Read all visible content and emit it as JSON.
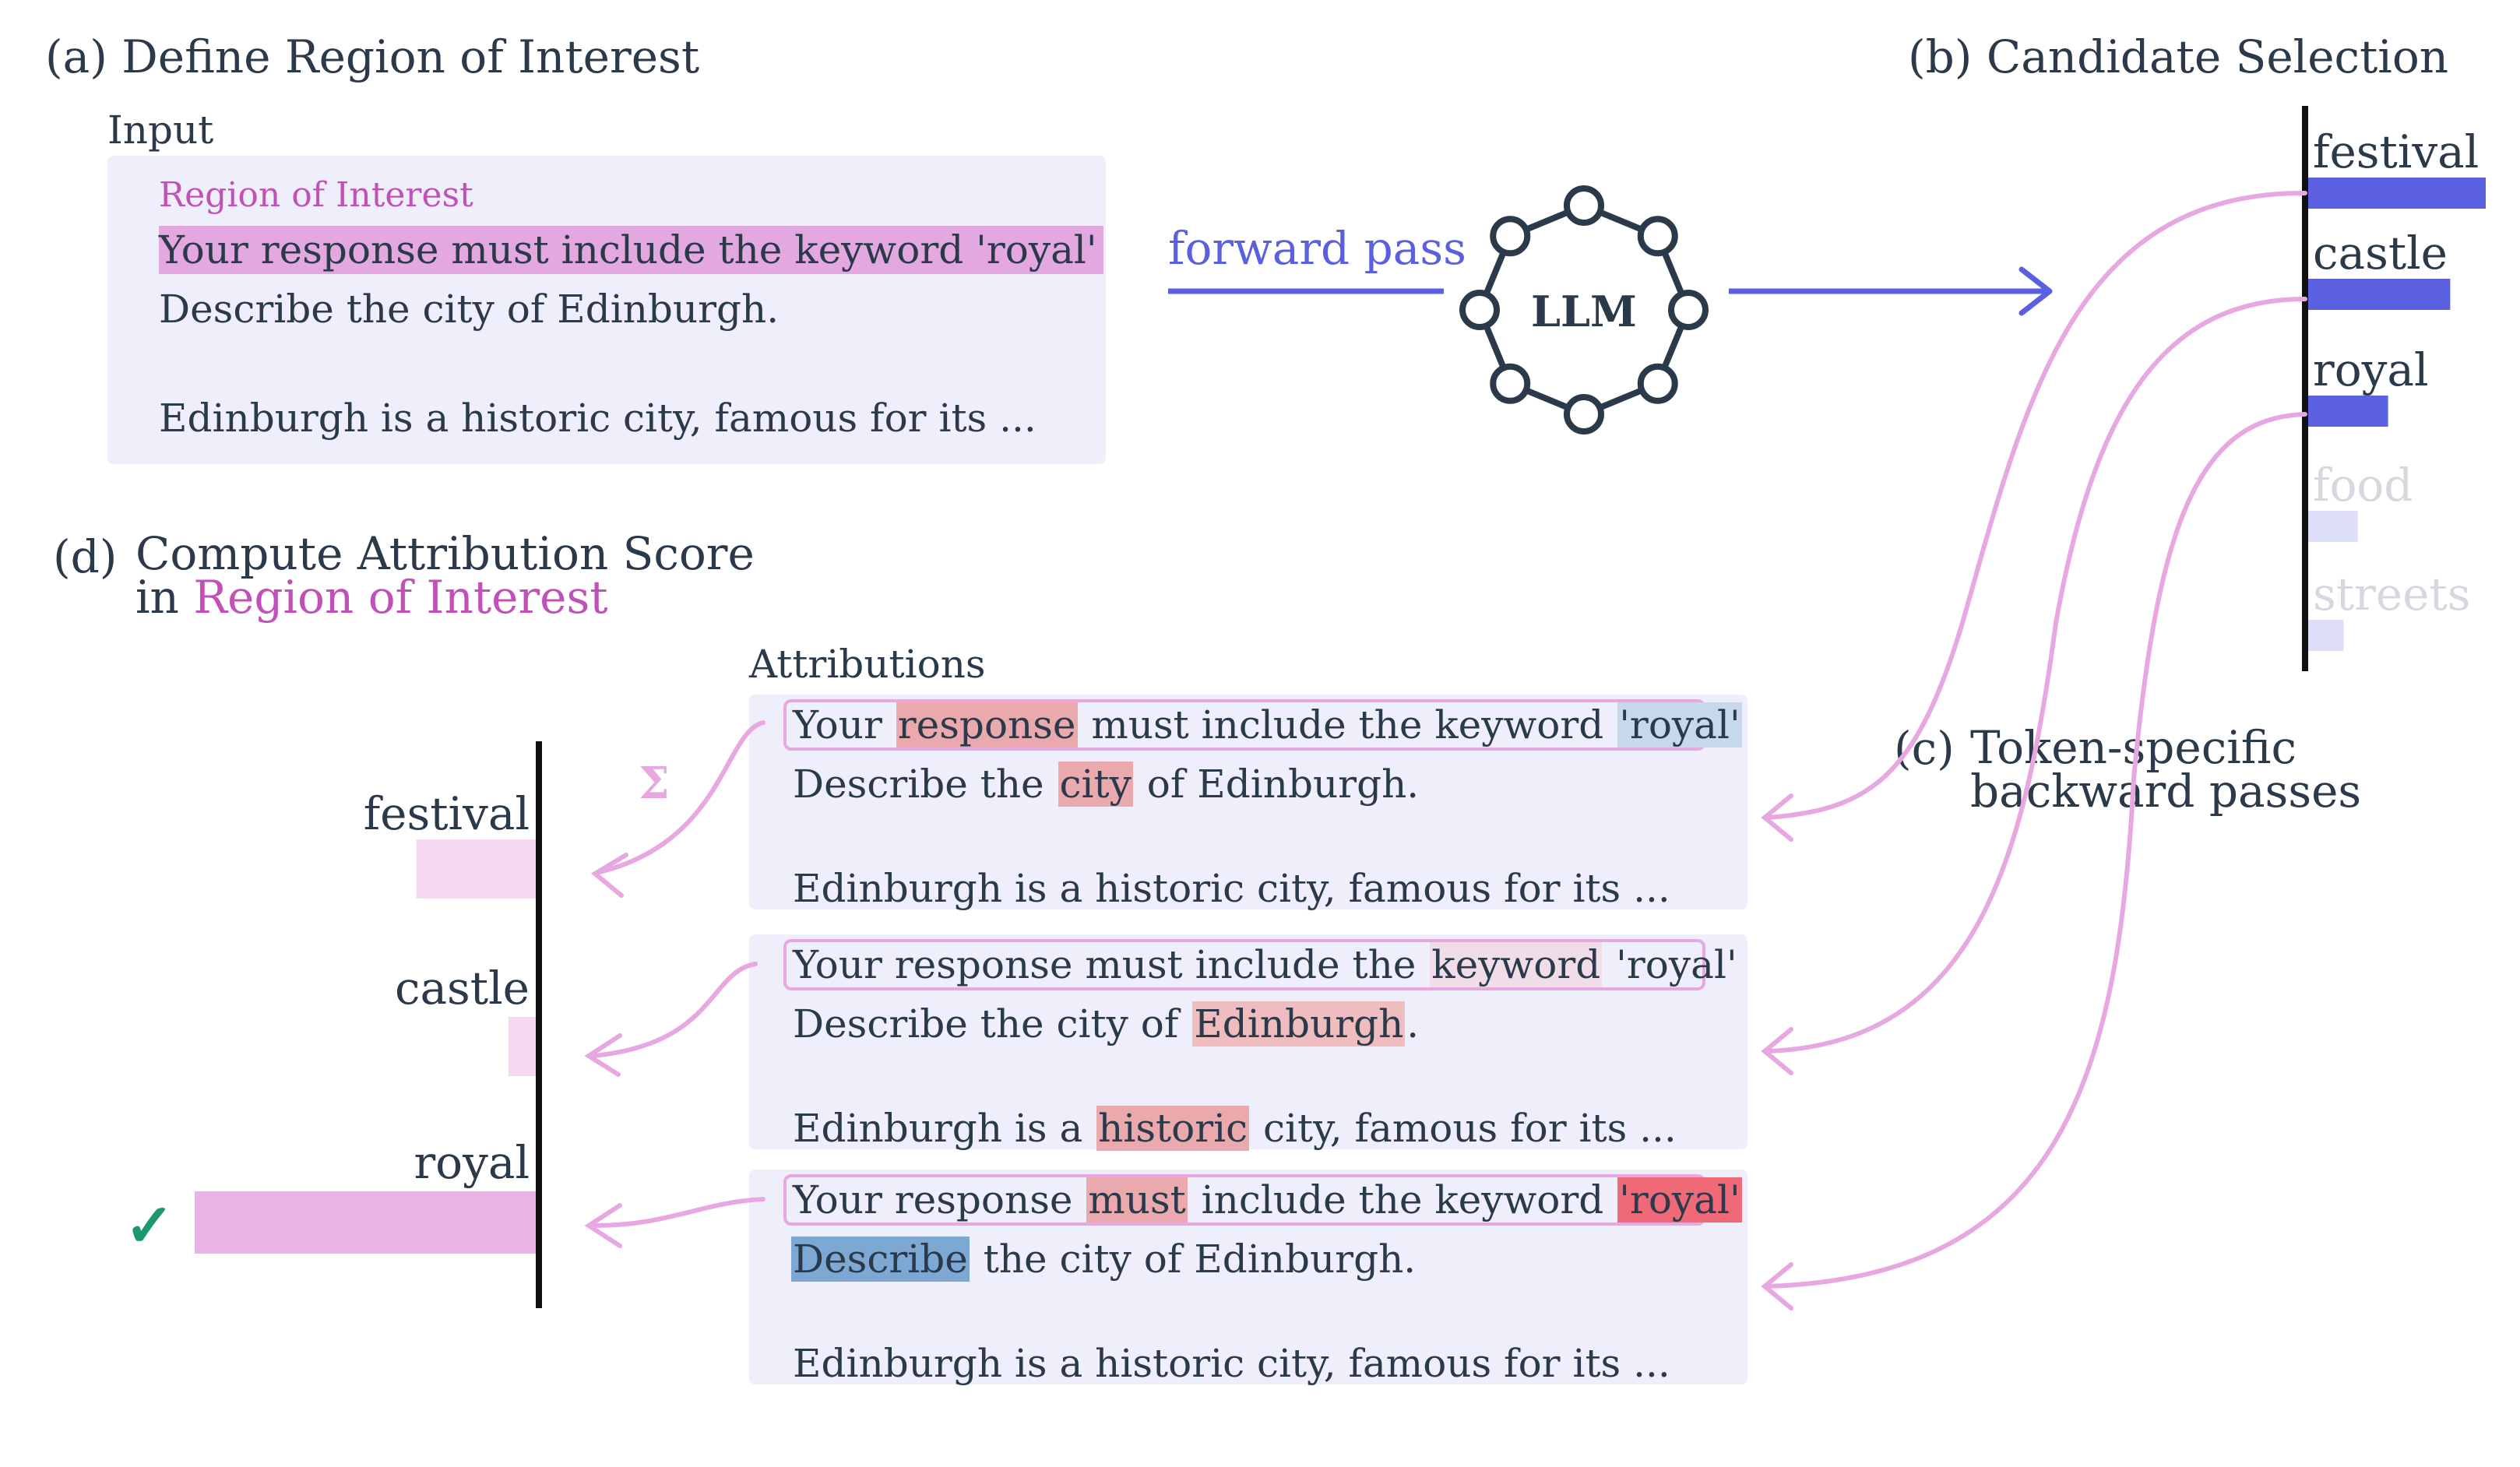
{
  "sections": {
    "a": "(a) Define Region of Interest",
    "b": "(b) Candidate Selection",
    "c_letter": "(c)",
    "c_line1": "Token-specific",
    "c_line2": "backward passes",
    "d_letter": "(d)",
    "d_line1": "Compute Attribution Score",
    "d_line2_prefix": "in",
    "d_line2_roi": "Region of Interest"
  },
  "input": {
    "label": "Input",
    "roi_label": "Region of Interest",
    "roi_text": "Your response must include the keyword 'royal'",
    "line2": "Describe the city of Edinburgh.",
    "line3": "Edinburgh is a historic city, famous for its ..."
  },
  "model": {
    "forward_label": "forward pass",
    "llm_label": "LLM"
  },
  "candidates": [
    {
      "token": "festival",
      "score": 1.0,
      "faded": false
    },
    {
      "token": "castle",
      "score": 0.8,
      "faded": false
    },
    {
      "token": "royal",
      "score": 0.45,
      "faded": false
    },
    {
      "token": "food",
      "score": 0.28,
      "faded": true
    },
    {
      "token": "streets",
      "score": 0.2,
      "faded": true
    }
  ],
  "attributions": {
    "label": "Attributions",
    "sum_symbol": "Σ",
    "rows": [
      {
        "tokens_l1": [
          {
            "t": "Your",
            "c": ""
          },
          {
            "t": "response",
            "c": "#e9a9ad"
          },
          {
            "t": "must include the keyword",
            "c": ""
          },
          {
            "t": "'royal'",
            "c": "#c7d7ec"
          }
        ],
        "tokens_l2": [
          {
            "t": "Describe the",
            "c": ""
          },
          {
            "t": "city",
            "c": "#e9a9ad"
          },
          {
            "t": "of Edinburgh.",
            "c": ""
          }
        ],
        "tokens_l3": [
          {
            "t": "Edinburgh is a historic city, famous for its ...",
            "c": ""
          }
        ]
      },
      {
        "tokens_l1": [
          {
            "t": "Your response must include the",
            "c": ""
          },
          {
            "t": "keyword",
            "c": "#f1dde8"
          },
          {
            "t": "'royal'",
            "c": ""
          }
        ],
        "tokens_l2": [
          {
            "t": "Describe the city of",
            "c": ""
          },
          {
            "t": "Edinburgh",
            "c": "#efbcc0"
          },
          {
            "t": ".",
            "c": ""
          }
        ],
        "tokens_l3": [
          {
            "t": "Edinburgh is a",
            "c": ""
          },
          {
            "t": "historic",
            "c": "#e9a9ad"
          },
          {
            "t": "city, famous for its ...",
            "c": ""
          }
        ]
      },
      {
        "tokens_l1": [
          {
            "t": "Your response",
            "c": ""
          },
          {
            "t": "must",
            "c": "#e9a9ad"
          },
          {
            "t": "include the keyword",
            "c": ""
          },
          {
            "t": "'royal'",
            "c": "#ef6a76"
          }
        ],
        "tokens_l2": [
          {
            "t": "Describe",
            "c": "#7ea8d4"
          },
          {
            "t": "the city of Edinburgh.",
            "c": ""
          }
        ],
        "tokens_l3": [
          {
            "t": "Edinburgh is a historic city, famous for its ...",
            "c": ""
          }
        ]
      }
    ]
  },
  "scores": [
    {
      "token": "festival",
      "score": 0.35,
      "selected": false
    },
    {
      "token": "castle",
      "score": 0.08,
      "selected": false
    },
    {
      "token": "royal",
      "score": 1.0,
      "selected": true
    }
  ],
  "check_symbol": "✓",
  "colors": {
    "blue": "#5b60e0",
    "pink": "#e7a8e2",
    "panel": "#eeeffb",
    "roi": "#c151b8",
    "check": "#1a9a6c"
  }
}
